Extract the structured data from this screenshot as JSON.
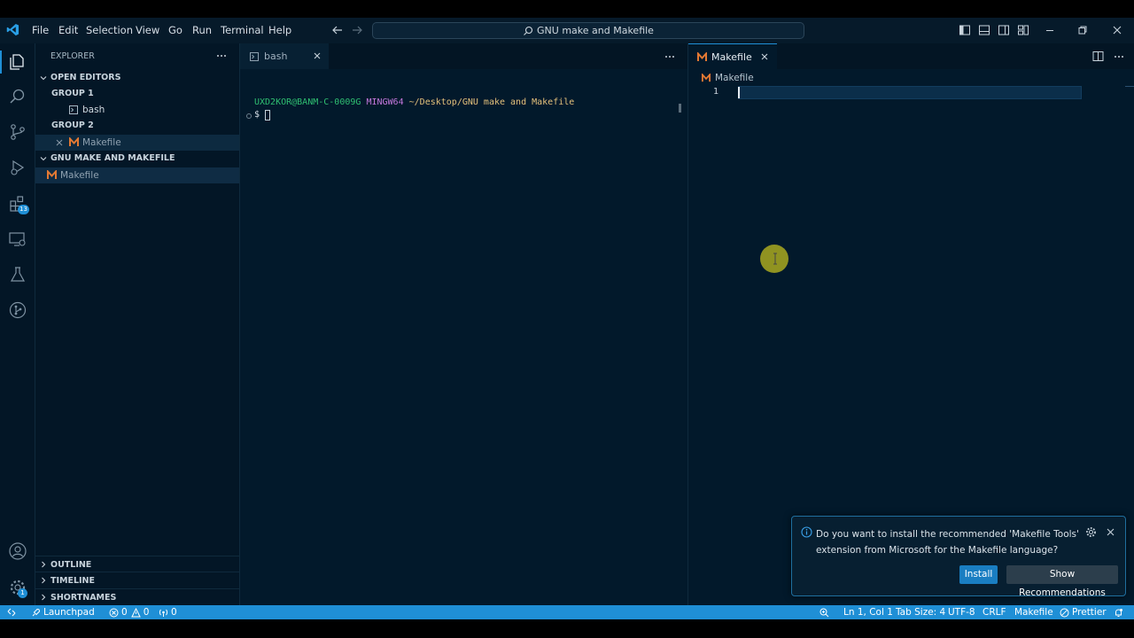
{
  "menu": [
    "File",
    "Edit",
    "Selection",
    "View",
    "Go",
    "Run",
    "Terminal",
    "Help"
  ],
  "command_center": "GNU make and Makefile",
  "activity_badges": {
    "extensions": "13",
    "manage": "1"
  },
  "sidebar": {
    "title": "EXPLORER",
    "open_editors": "OPEN EDITORS",
    "group1": "GROUP 1",
    "group1_file": "bash",
    "group2": "GROUP 2",
    "group2_file": "Makefile",
    "folder": "GNU MAKE AND MAKEFILE",
    "folder_file": "Makefile",
    "outline": "OUTLINE",
    "timeline": "TIMELINE",
    "shortnames": "SHORTNAMES"
  },
  "left_editor": {
    "tab": "bash",
    "prompt_user": "UXD2KOR@BANM-C-0009G",
    "prompt_env": "MINGW64",
    "prompt_path": "~/Desktop/GNU make and Makefile",
    "prompt_symbol": "$"
  },
  "right_editor": {
    "tab": "Makefile",
    "breadcrumb": "Makefile",
    "line_number": "1"
  },
  "notification": {
    "line1": "Do you want to install the recommended 'Makefile Tools'",
    "line2": "extension from Microsoft for the Makefile language?",
    "install": "Install",
    "show": "Show Recommendations"
  },
  "status": {
    "launchpad": "Launchpad",
    "errors": "0",
    "warnings": "0",
    "ports": "0",
    "position": "Ln 1, Col 1",
    "tabsize": "Tab Size: 4",
    "encoding": "UTF-8",
    "eol": "CRLF",
    "language": "Makefile",
    "prettier": "Prettier"
  },
  "colors": {
    "accent": "#1f8fd6",
    "background": "#02192b",
    "makefile_icon": "#e37933",
    "prompt_user": "#2fbf71",
    "prompt_env": "#c678dd",
    "prompt_path": "#e5c07b"
  }
}
